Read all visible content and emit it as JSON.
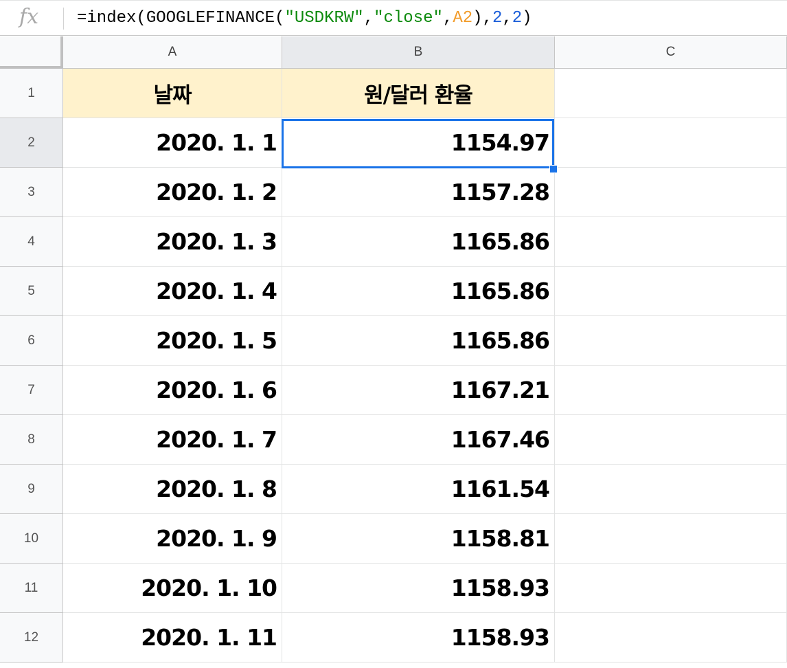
{
  "formula_bar": {
    "fx_label": "fx",
    "formula_parts": {
      "p1": "=index(GOOGLEFINANCE(",
      "p2": "\"USDKRW\"",
      "p3": ",",
      "p4": "\"close\"",
      "p5": ",",
      "p6": "A2",
      "p7": "),",
      "p8": "2",
      "p9": ",",
      "p10": "2",
      "p11": ")"
    }
  },
  "columns": [
    "A",
    "B",
    "C"
  ],
  "selected_cell": "B2",
  "header_row": {
    "row": "1",
    "a": "날짜",
    "b": "원/달러 환율"
  },
  "rows": [
    {
      "row": "2",
      "date": "2020. 1. 1",
      "rate": "1154.97"
    },
    {
      "row": "3",
      "date": "2020. 1. 2",
      "rate": "1157.28"
    },
    {
      "row": "4",
      "date": "2020. 1. 3",
      "rate": "1165.86"
    },
    {
      "row": "5",
      "date": "2020. 1. 4",
      "rate": "1165.86"
    },
    {
      "row": "6",
      "date": "2020. 1. 5",
      "rate": "1165.86"
    },
    {
      "row": "7",
      "date": "2020. 1. 6",
      "rate": "1167.21"
    },
    {
      "row": "8",
      "date": "2020. 1. 7",
      "rate": "1167.46"
    },
    {
      "row": "9",
      "date": "2020. 1. 8",
      "rate": "1161.54"
    },
    {
      "row": "10",
      "date": "2020. 1. 9",
      "rate": "1158.81"
    },
    {
      "row": "11",
      "date": "2020. 1. 10",
      "rate": "1158.93"
    },
    {
      "row": "12",
      "date": "2020. 1. 11",
      "rate": "1158.93"
    }
  ],
  "colors": {
    "header_fill": "#fff2cc",
    "selection": "#1a73e8"
  }
}
